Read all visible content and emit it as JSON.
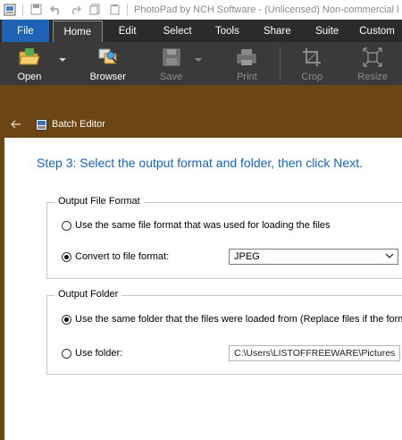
{
  "window": {
    "title": "PhotoPad by NCH Software - (Unlicensed) Non-commercial l"
  },
  "ribbon": {
    "tabs": [
      {
        "label": "File"
      },
      {
        "label": "Home"
      },
      {
        "label": "Edit"
      },
      {
        "label": "Select"
      },
      {
        "label": "Tools"
      },
      {
        "label": "Share"
      },
      {
        "label": "Suite"
      },
      {
        "label": "Custom"
      }
    ],
    "active_tab": "Home"
  },
  "toolbar": {
    "open_label": "Open",
    "browser_label": "Browser",
    "save_label": "Save",
    "print_label": "Print",
    "crop_label": "Crop",
    "resize_label": "Resize"
  },
  "panel": {
    "title": "Batch Editor"
  },
  "step": {
    "heading": "Step 3: Select the output format and folder, then click Next."
  },
  "output_format": {
    "legend": "Output File Format",
    "same_format_label": "Use the same file format that was used for loading the files",
    "convert_label": "Convert to file format:",
    "format_value": "JPEG",
    "selected": "convert"
  },
  "output_folder": {
    "legend": "Output Folder",
    "same_folder_label": "Use the same folder that the files were loaded from (Replace files if the forma",
    "use_folder_label": "Use folder:",
    "folder_path": "C:\\Users\\LISTOFFREEWARE\\Pictures",
    "selected": "same"
  },
  "colors": {
    "ribbon_dark": "#2b2b2b",
    "toolbar": "#3a3a3a",
    "file_tab": "#1e63b5",
    "accent_brown": "#6b4513",
    "step_text": "#1565c0"
  }
}
